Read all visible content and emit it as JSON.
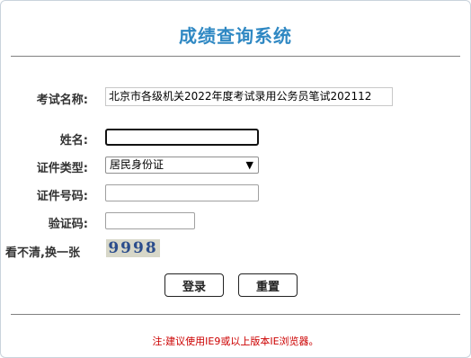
{
  "header": {
    "title": "成绩查询系统"
  },
  "form": {
    "exam_label": "考试名称:",
    "exam_value": "北京市各级机关2022年度考试录用公务员笔试202112",
    "name_label": "姓名:",
    "name_value": "",
    "idtype_label": "证件类型:",
    "idtype_value": "居民身份证",
    "idnum_label": "证件号码:",
    "idnum_value": "",
    "captcha_label": "验证码:",
    "captcha_value": "",
    "refresh_label": "看不清,换一张",
    "captcha_text": "9998"
  },
  "buttons": {
    "login": "登录",
    "reset": "重置"
  },
  "footer": {
    "notice": "注:建议使用IE9或以上版本IE浏览器。"
  },
  "colors": {
    "title": "#2f88c3",
    "notice": "#cc0000"
  }
}
